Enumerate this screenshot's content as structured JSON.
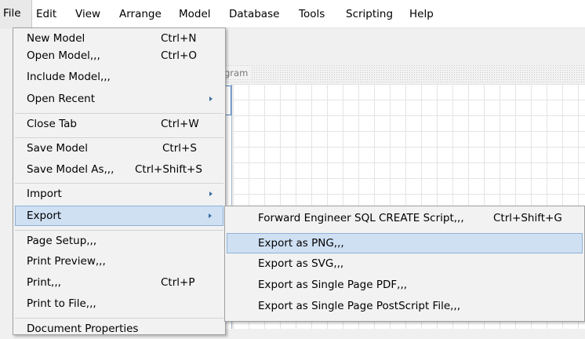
{
  "menubar": {
    "items": [
      "File",
      "Edit",
      "View",
      "Arrange",
      "Model",
      "Database",
      "Tools",
      "Scripting",
      "Help"
    ]
  },
  "diagram": {
    "tab_label": "gram"
  },
  "file_menu": {
    "items": [
      {
        "label": "New Model",
        "shortcut": "Ctrl+N"
      },
      {
        "label": "Open Model,,,",
        "shortcut": "Ctrl+O"
      },
      {
        "label": "Include Model,,,",
        "shortcut": ""
      },
      {
        "label": "Open Recent",
        "shortcut": "",
        "submenu": true
      },
      {
        "label": "Close Tab",
        "shortcut": "Ctrl+W"
      },
      {
        "label": "Save Model",
        "shortcut": "Ctrl+S"
      },
      {
        "label": "Save Model As,,,",
        "shortcut": "Ctrl+Shift+S"
      },
      {
        "label": "Import",
        "shortcut": "",
        "submenu": true
      },
      {
        "label": "Export",
        "shortcut": "",
        "submenu": true,
        "highlighted": true
      },
      {
        "label": "Page Setup,,,",
        "shortcut": ""
      },
      {
        "label": "Print Preview,,,",
        "shortcut": ""
      },
      {
        "label": "Print,,,",
        "shortcut": "Ctrl+P"
      },
      {
        "label": "Print to File,,,",
        "shortcut": ""
      },
      {
        "label": "Document Properties",
        "shortcut": ""
      }
    ]
  },
  "export_submenu": {
    "items": [
      {
        "label": "Forward Engineer SQL CREATE Script,,,",
        "shortcut": "Ctrl+Shift+G"
      },
      {
        "label": "Export as PNG,,,",
        "shortcut": "",
        "highlighted": true
      },
      {
        "label": "Export as SVG,,,",
        "shortcut": ""
      },
      {
        "label": "Export as Single Page PDF,,,",
        "shortcut": ""
      },
      {
        "label": "Export as Single Page PostScript File,,,",
        "shortcut": ""
      }
    ]
  },
  "colors": {
    "highlight_bg": "#cfe0f3",
    "highlight_border": "#8fb1d6",
    "submenu_arrow": "#3a6ea5",
    "menu_bg": "#f2f2f2"
  }
}
